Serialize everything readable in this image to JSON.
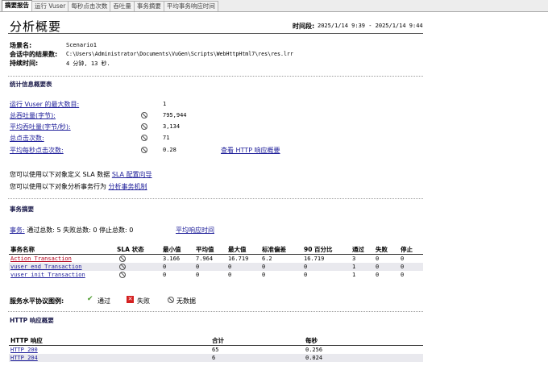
{
  "tabs": [
    "摘要报告",
    "运行 Vuser",
    "每秒点击次数",
    "吞吐量",
    "事务摘要",
    "平均事务响应时间"
  ],
  "title": "分析概要",
  "time_period": {
    "label": "时间段:",
    "value": "2025/1/14 9:39 - 2025/1/14 9:44"
  },
  "scenario": {
    "name_label": "场景名:",
    "name_value": "Scenario1",
    "results_label": "会话中的结果数:",
    "results_value": "C:\\Users\\Administrator\\Documents\\VuGen\\Scripts\\WebHttpHtml7\\res\\res.lrr",
    "duration_label": "持续时间:",
    "duration_value": "4 分钟, 13 秒."
  },
  "stats": {
    "heading": "统计信息概要表",
    "rows": [
      {
        "label": "运行 Vuser 的最大数目:",
        "value": "1",
        "icon": false
      },
      {
        "label": "总吞吐量(字节):",
        "value": "795,944",
        "icon": true
      },
      {
        "label": "平均吞吐量(字节/秒):",
        "value": "3,134",
        "icon": true
      },
      {
        "label": "总点击次数:",
        "value": "71",
        "icon": true
      },
      {
        "label": "平均每秒点击次数:",
        "value": "0.28",
        "icon": true
      }
    ],
    "http_link": "查看 HTTP 响应概要"
  },
  "sla_text": {
    "line1_prefix": "您可以使用以下对象定义 SLA 数据",
    "line1_link": "SLA 配置向导",
    "line2_prefix": "您可以使用以下对象分析事务行为",
    "line2_link": "分析事务机制"
  },
  "tx_summary": {
    "heading": "事务摘要",
    "label": "事务:",
    "stats": "通过总数: 5 失败总数: 0 停止总数: 0",
    "avg_link": "平均响应时间",
    "columns": [
      "事务名称",
      "SLA 状态",
      "最小值",
      "平均值",
      "最大值",
      "标准偏差",
      "90 百分比",
      "通过",
      "失败",
      "停止"
    ],
    "rows": [
      {
        "name": "Action_Transaction",
        "min": "3.166",
        "avg": "7.964",
        "max": "16.719",
        "std": "6.2",
        "p90": "16.719",
        "pass": "3",
        "fail": "0",
        "stop": "0"
      },
      {
        "name": "vuser_end_Transaction",
        "min": "0",
        "avg": "0",
        "max": "0",
        "std": "0",
        "p90": "0",
        "pass": "1",
        "fail": "0",
        "stop": "0"
      },
      {
        "name": "vuser_init_Transaction",
        "min": "0",
        "avg": "0",
        "max": "0",
        "std": "0",
        "p90": "0",
        "pass": "1",
        "fail": "0",
        "stop": "0"
      }
    ]
  },
  "legend": {
    "label": "服务水平协议图例:",
    "pass": "通过",
    "fail": "失败",
    "nodata": "无数据"
  },
  "http": {
    "heading": "HTTP 响应概要",
    "columns": [
      "HTTP 响应",
      "合计",
      "每秒"
    ],
    "rows": [
      {
        "code": "HTTP_200",
        "total": "65",
        "per_sec": "0.256"
      },
      {
        "code": "HTTP_204",
        "total": "6",
        "per_sec": "0.024"
      }
    ]
  },
  "colors": {
    "link": "#1d1d99",
    "failed_transaction": "#b2001a",
    "pass_icon": "#4a9a2a",
    "fail_icon": "#d42020"
  }
}
